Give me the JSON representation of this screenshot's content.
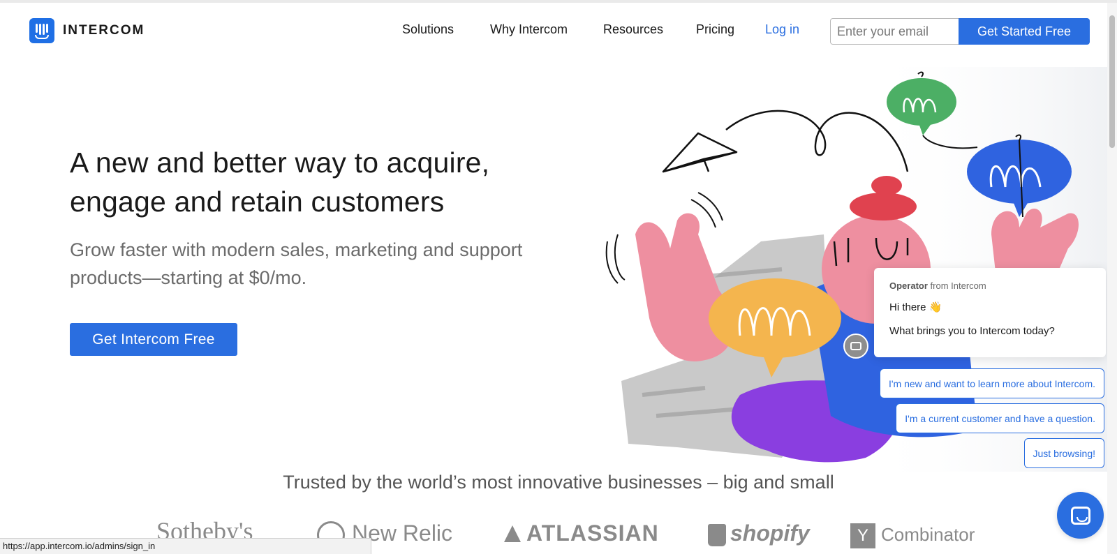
{
  "header": {
    "logo_text": "INTERCOM",
    "nav": [
      {
        "label": "Solutions"
      },
      {
        "label": "Why Intercom"
      },
      {
        "label": "Resources"
      },
      {
        "label": "Pricing"
      },
      {
        "label": "Log in"
      }
    ],
    "email_placeholder": "Enter your email",
    "cta_label": "Get Started Free"
  },
  "hero": {
    "title": "A new and better way to acquire, engage and retain customers",
    "subtitle": "Grow faster with modern sales, marketing and support products—starting at $0/mo.",
    "cta_label": "Get Intercom Free"
  },
  "chat": {
    "from_name": "Operator",
    "from_rest": " from Intercom",
    "greeting": "Hi there 👋",
    "question": "What brings you to Intercom today?",
    "replies": [
      "I'm new and want to learn more about Intercom.",
      "I'm a current customer and have a question.",
      "Just browsing!"
    ]
  },
  "trusted": {
    "heading": "Trusted by the world’s most innovative businesses – big and small",
    "brands": [
      "Sotheby's",
      "New Relic",
      "ATLASSIAN",
      "shopify",
      "Combinator"
    ],
    "yc_letter": "Y"
  },
  "status_url": "https://app.intercom.io/admins/sign_in",
  "colors": {
    "brand_blue": "#2a6ee0",
    "pink": "#ee8fa0",
    "yellow": "#f4b54e",
    "green": "#4caf65",
    "purple": "#8a3ee0"
  }
}
